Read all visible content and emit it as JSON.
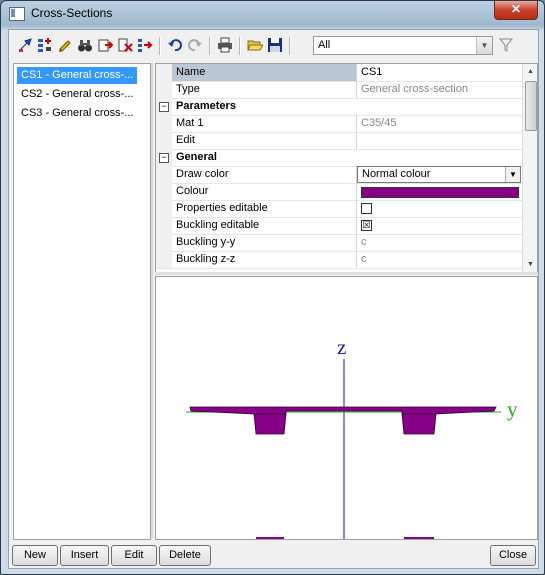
{
  "window": {
    "title": "Cross-Sections",
    "close_glyph": "✕"
  },
  "toolbar": {
    "icons": [
      "pick-icon",
      "filter-select-icon",
      "edit-pencil-icon",
      "binoculars-icon",
      "export-icon",
      "delete-icon",
      "list-icon",
      "undo-icon",
      "redo-icon",
      "print-icon",
      "open-folder-icon",
      "save-icon",
      "funnel-icon"
    ],
    "filter": {
      "value": "All"
    }
  },
  "list": {
    "items": [
      {
        "label": "CS1 - General cross-...",
        "selected": true
      },
      {
        "label": "CS2 - General cross-...",
        "selected": false
      },
      {
        "label": "CS3 - General cross-...",
        "selected": false
      }
    ]
  },
  "properties": {
    "name_label": "Name",
    "name_value": "CS1",
    "type_label": "Type",
    "type_value": "General cross-section",
    "parameters_header": "Parameters",
    "mat_label": "Mat 1",
    "mat_value": "C35/45",
    "edit_label": "Edit",
    "general_header": "General",
    "draw_color_label": "Draw color",
    "draw_color_value": "Normal colour",
    "colour_label": "Colour",
    "colour_value": "#880088",
    "props_editable_label": "Properties editable",
    "props_editable_checked": false,
    "buckling_editable_label": "Buckling editable",
    "buckling_editable_checked": true,
    "check_glyph": "☒",
    "buckling_yy_label": "Buckling y-y",
    "buckling_yy_value": "c",
    "buckling_zz_label": "Buckling z-z",
    "buckling_zz_value": "c",
    "expander_glyph": "−"
  },
  "preview": {
    "z_label": "z",
    "y_label": "y",
    "axis_z_color": "#1a1a99",
    "axis_y_color": "#22aa22",
    "section_color": "#880088"
  },
  "buttons": {
    "new": "New",
    "insert": "Insert",
    "edit": "Edit",
    "delete": "Delete",
    "close": "Close"
  }
}
